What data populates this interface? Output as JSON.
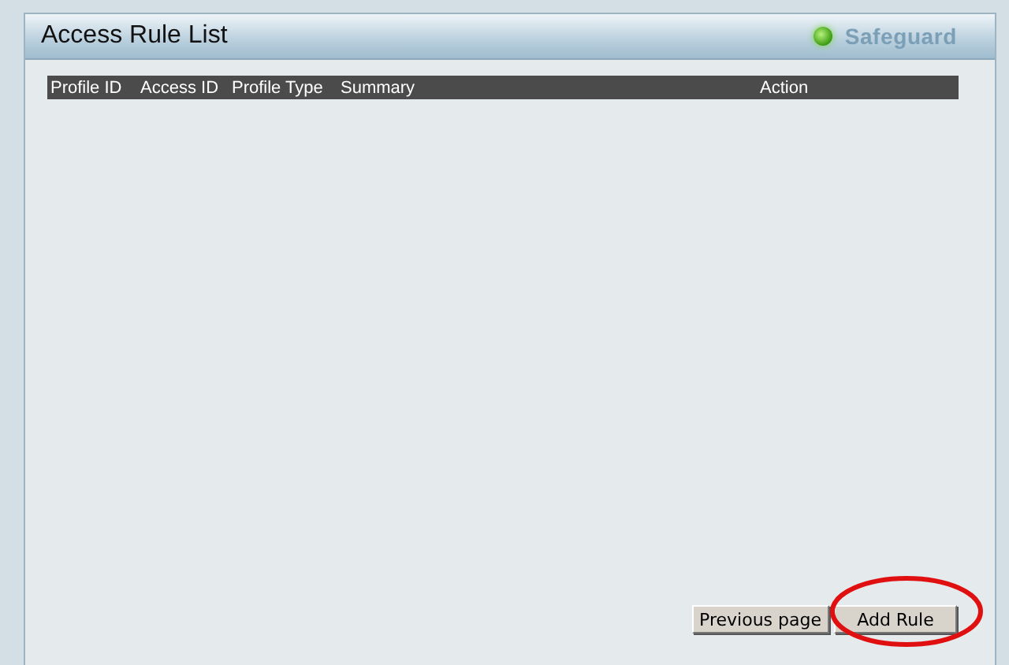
{
  "panel": {
    "title": "Access Rule List",
    "status": {
      "label": "Safeguard",
      "on": true
    }
  },
  "table": {
    "columns": [
      "Profile ID",
      "Access ID",
      "Profile Type",
      "Summary",
      "Action"
    ]
  },
  "buttons": [
    "Previous page",
    "Add Rule"
  ]
}
